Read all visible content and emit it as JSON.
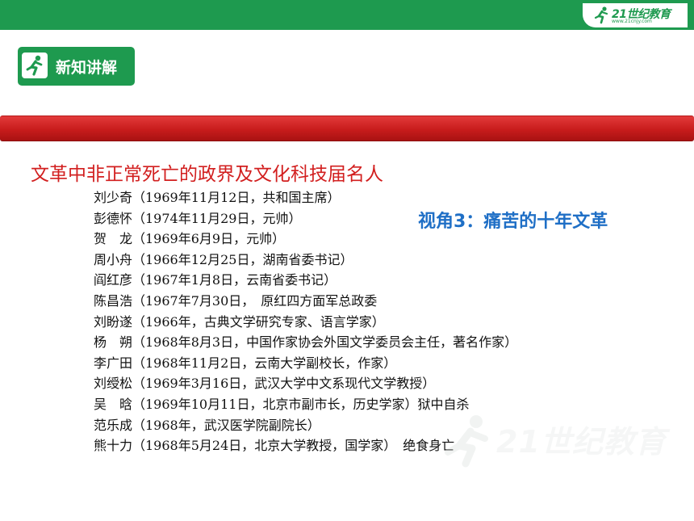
{
  "brand": {
    "name": "21世纪教育",
    "url": "www.21cnjy.com"
  },
  "section": {
    "title": "新知讲解",
    "icon": "running-person-icon"
  },
  "heading": "文革中非正常死亡的政界及文化科技届名人",
  "viewpoint": "视角3：痛苦的十年文革",
  "people": [
    "刘少奇（1969年11月12日，共和国主席）",
    "彭德怀（1974年11月29日，元帅）",
    "贺　龙（1969年6月9日，元帅）",
    "周小舟（1966年12月25日，湖南省委书记）",
    "阎红彦（1967年1月8日，云南省委书记）",
    "陈昌浩（1967年7月30日，　原红四方面军总政委",
    "刘盼遂（1966年，古典文学研究专家、语言学家）",
    "杨　朔（1968年8月3日，中国作家协会外国文学委员会主任，著名作家）",
    "李广田（1968年11月2日，云南大学副校长，作家）",
    "刘绶松（1969年3月16日，武汉大学中文系现代文学教授）",
    "吴　晗（1969年10月11日，北京市副市长，历史学家）狱中自杀",
    "范乐成（1968年，武汉医学院副院长）",
    "熊十力（1968年5月24日，北京大学教授，国学家）　绝食身亡"
  ],
  "watermark": {
    "name": "21世纪教育",
    "url": "www.21cnjy.com"
  },
  "colors": {
    "green": "#1e9a4f",
    "red_band": "#c81c1c",
    "heading_red": "#d21f1f",
    "viewpoint_blue": "#1f6fc6"
  }
}
